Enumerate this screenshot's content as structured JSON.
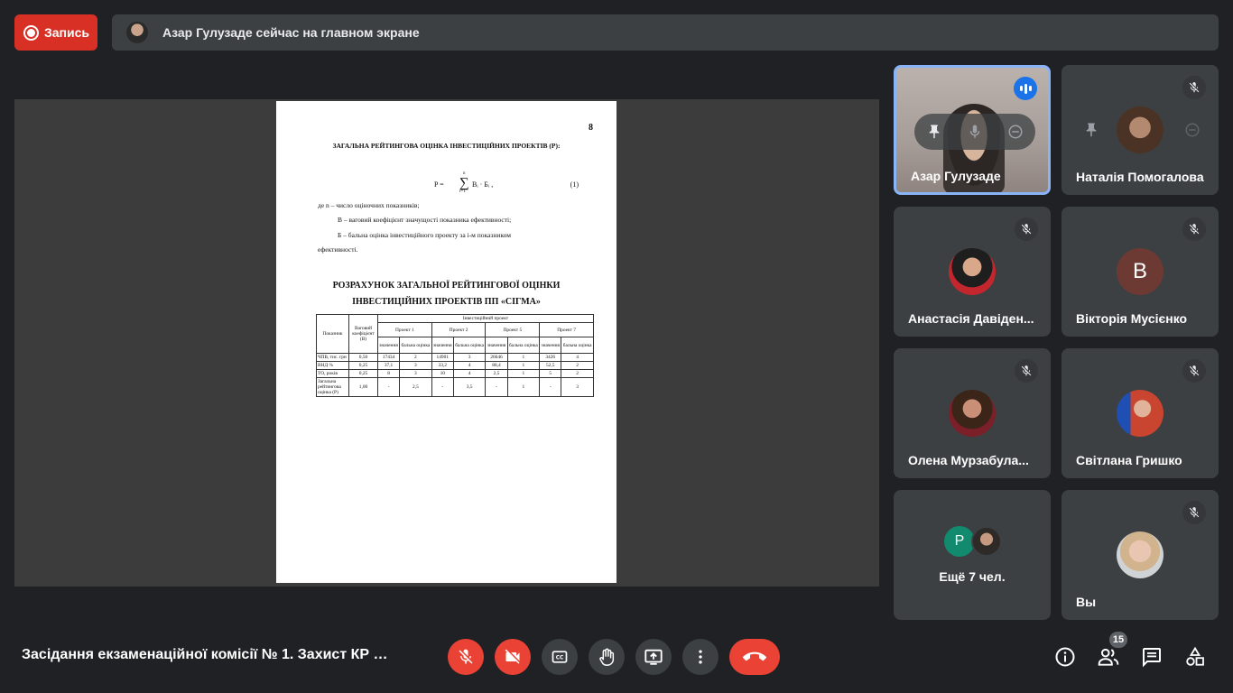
{
  "topbar": {
    "record_label": "Запись",
    "presenting_text": "Азар Гулузаде сейчас на главном экране"
  },
  "document": {
    "page_number": "8",
    "heading": "ЗАГАЛЬНА РЕЙТИНГОВА ОЦІНКА ІНВЕСТИЦІЙНИХ ПРОЕКТІВ (Р):",
    "formula_lhs": "P =",
    "formula_sum": "∑",
    "formula_upper": "n",
    "formula_lower": "i=1",
    "formula_rhs": "Bᵢ · Бᵢ ,",
    "formula_number": "(1)",
    "line1": "де     n –  число оціночних показників;",
    "line2": "В –   ваговий коефіцієнт значущості показника ефективності;",
    "line3": "Б   –   бальна   оцінка   інвестиційного   проекту   за   і-м   показником",
    "line4": "ефективності.",
    "title2_line1": "РОЗРАХУНОК ЗАГАЛЬНОЇ РЕЙТИНГОВОЇ ОЦІНКИ",
    "title2_line2": "ІНВЕСТИЦІЙНИХ ПРОЕКТІВ ПП «СІГМА»",
    "table": {
      "col_indicator": "Показник",
      "col_weight": "Ваговий коефіцієнт (В)",
      "col_group": "Інвестиційний проект",
      "projects": [
        "Проект 1",
        "Проект 2",
        "Проект 5",
        "Проект 7"
      ],
      "sub_value": "значення",
      "sub_score": "бальна оцінка",
      "rows": [
        [
          "ЧПВ, тис. грн",
          "0,50",
          "17434",
          "2",
          "14901",
          "3",
          "26646",
          "1",
          "3426",
          "4"
        ],
        [
          "ВНД %",
          "0,25",
          "37,1",
          "3",
          "33,2",
          "4",
          "88,4",
          "1",
          "52,5",
          "2"
        ],
        [
          "ТО, років",
          "0,25",
          "8",
          "3",
          "10",
          "4",
          "2,5",
          "1",
          "5",
          "2"
        ],
        [
          "Загальна рейтингова оцінка (Р)",
          "1,00",
          "-",
          "2,5",
          "-",
          "3,5",
          "-",
          "1",
          "-",
          "3"
        ]
      ]
    }
  },
  "participants": [
    {
      "name": "Азар Гулузаде",
      "speaking": true
    },
    {
      "name": "Наталія Помогалова",
      "muted": true
    },
    {
      "name": "Анастасія Давіден...",
      "muted": true
    },
    {
      "name": "Вікторія Мусієнко",
      "muted": true,
      "initial": "В"
    },
    {
      "name": "Олена Мурзабула...",
      "muted": true
    },
    {
      "name": "Світлана Гришко",
      "muted": true
    },
    {
      "name": "Вы",
      "muted": true
    }
  ],
  "more": {
    "initial": "P",
    "label": "Ещё 7 чел."
  },
  "bottombar": {
    "meeting_title": "Засідання екзаменаційної комісії № 1. Захист КР м...",
    "people_count": "15"
  },
  "colors": {
    "background": "#202124",
    "tile": "#3c4043",
    "danger": "#ea4335",
    "accent": "#8ab4f8",
    "speaking": "#1a73e8"
  },
  "icons": [
    "record-icon",
    "mic-off-icon",
    "camera-off-icon",
    "captions-icon",
    "raise-hand-icon",
    "present-screen-icon",
    "more-vert-icon",
    "end-call-icon",
    "info-icon",
    "people-icon",
    "chat-icon",
    "activities-icon",
    "pin-icon",
    "remove-icon"
  ]
}
